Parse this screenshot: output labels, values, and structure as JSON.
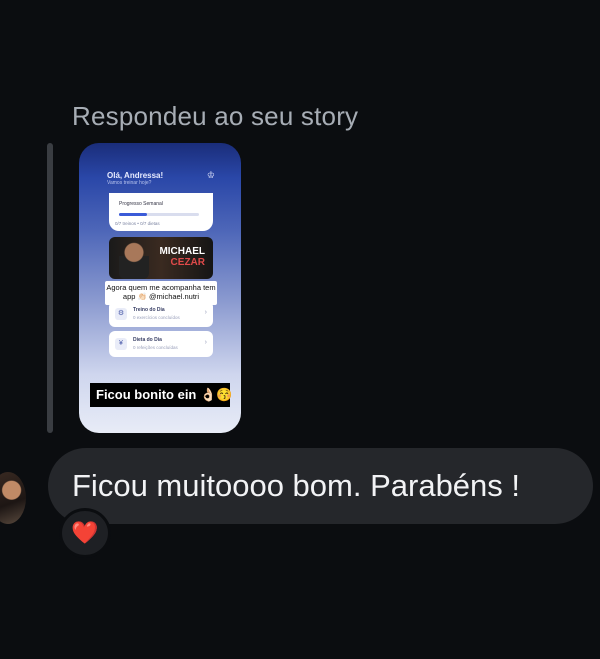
{
  "reply_label": "Respondeu ao seu story",
  "story": {
    "greeting": "Olá, Andressa!",
    "greeting_sub": "Vamos treinar hoje?",
    "progress_label": "Progresso Semanal",
    "progress_caption": "0/7 treinos • 0/7 dietas",
    "progress_value": 0.35,
    "banner_name_1": "MICHAEL",
    "banner_name_2": "CEZAR",
    "caption_text": "Agora quem me acompanha tem app 👏🏻 @michael.nutri",
    "card1_title": "Treino do Dia",
    "card1_sub": "0 exercícios concluídos",
    "card2_title": "Dieta do Dia",
    "card2_sub": "0 refeições concluídas",
    "sticker_text": "Ficou bonito ein 👌🏻😚"
  },
  "message": {
    "text": "Ficou muitoooo bom. Parabéns !",
    "reaction": "❤️"
  },
  "colors": {
    "background": "#0b0d10",
    "bubble": "#25272b",
    "label": "#a7adb5",
    "heart": "#e0192a"
  }
}
